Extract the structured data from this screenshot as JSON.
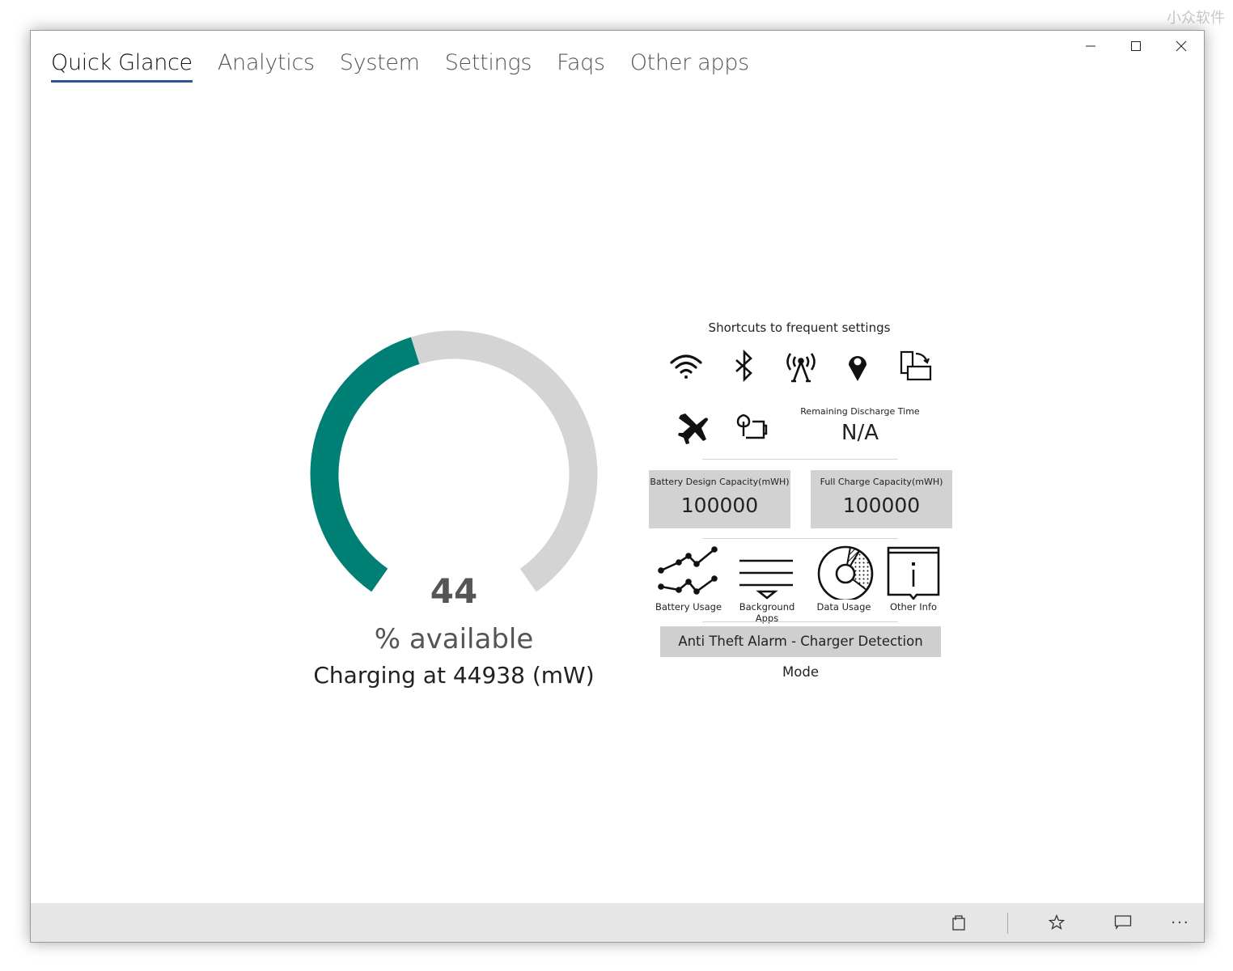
{
  "watermark": "小众软件",
  "window": {
    "controls": [
      "minimize",
      "maximize",
      "close"
    ]
  },
  "tabs": [
    {
      "label": "Quick Glance",
      "active": true
    },
    {
      "label": "Analytics"
    },
    {
      "label": "System"
    },
    {
      "label": "Settings"
    },
    {
      "label": "Faqs"
    },
    {
      "label": "Other apps"
    }
  ],
  "gauge": {
    "percent": 44,
    "value_text": "44",
    "label": "% available",
    "fill_color": "#008075",
    "track_color": "#d4d4d4"
  },
  "charging_text": "Charging at 44938 (mW)",
  "shortcuts": {
    "title": "Shortcuts to frequent settings",
    "icons": [
      "wifi-icon",
      "bluetooth-icon",
      "cellular-antenna-icon",
      "location-icon",
      "rotation-lock-icon",
      "airplane-mode-icon",
      "battery-saver-icon"
    ]
  },
  "remaining": {
    "label": "Remaining Discharge Time",
    "value": "N/A"
  },
  "capacity": [
    {
      "label": "Battery Design Capacity(mWH)",
      "value": "100000"
    },
    {
      "label": "Full Charge Capacity(mWH)",
      "value": "100000"
    }
  ],
  "tools": [
    {
      "label": "Battery Usage",
      "icon": "line-chart-icon"
    },
    {
      "label": "Background Apps",
      "icon": "list-dropdown-icon"
    },
    {
      "label": "Data Usage",
      "icon": "pie-chart-icon"
    },
    {
      "label": "Other Info",
      "icon": "info-icon"
    }
  ],
  "alarm_button": "Anti Theft Alarm - Charger Detection Mode",
  "appbar": {
    "icons": [
      "store-bag-icon",
      "star-icon",
      "feedback-icon",
      "more-icon"
    ],
    "more": "···"
  }
}
